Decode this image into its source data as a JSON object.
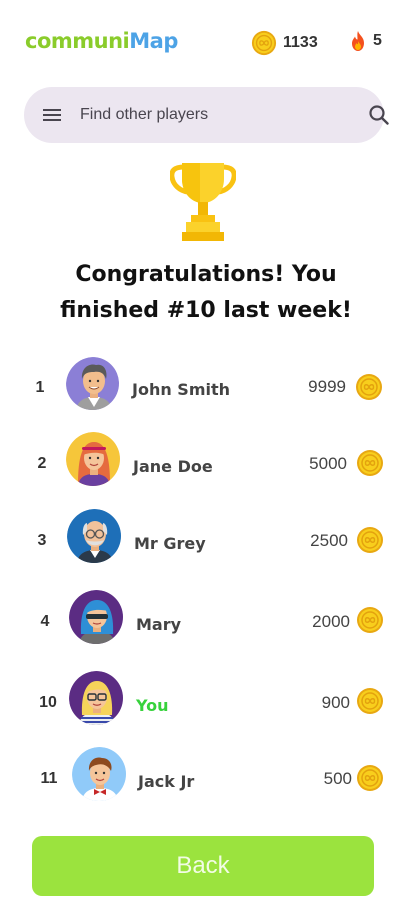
{
  "app": {
    "logo_part1": "communi",
    "logo_part2": "Map",
    "coins": "1133",
    "streak": "5"
  },
  "search": {
    "placeholder": "Find other players"
  },
  "result": {
    "line1": "Congratulations! You",
    "line2": "finished #10 last week!"
  },
  "leaderboard": [
    {
      "rank": "1",
      "name": "John Smith",
      "score": "9999",
      "avatar": "man-gray-hair-avatar"
    },
    {
      "rank": "2",
      "name": "Jane Doe",
      "score": "5000",
      "avatar": "woman-red-hair-avatar"
    },
    {
      "rank": "3",
      "name": "Mr Grey",
      "score": "2500",
      "avatar": "old-man-glasses-avatar"
    },
    {
      "rank": "4",
      "name": "Mary",
      "score": "2000",
      "avatar": "woman-blue-hair-avatar"
    },
    {
      "rank": "10",
      "name": "You",
      "score": "900",
      "avatar": "woman-blonde-glasses-avatar",
      "highlight": "#37D23C"
    },
    {
      "rank": "11",
      "name": "Jack Jr",
      "score": "500",
      "avatar": "boy-bowtie-avatar"
    }
  ],
  "back_label": "Back",
  "colors": {
    "brand_green": "#8ACC2B",
    "brand_blue": "#4DA3E6",
    "search_bg": "#ECE6F0",
    "button_green": "#9BE33E",
    "you_green": "#37D23C",
    "coin_gold": "#F5C518"
  }
}
